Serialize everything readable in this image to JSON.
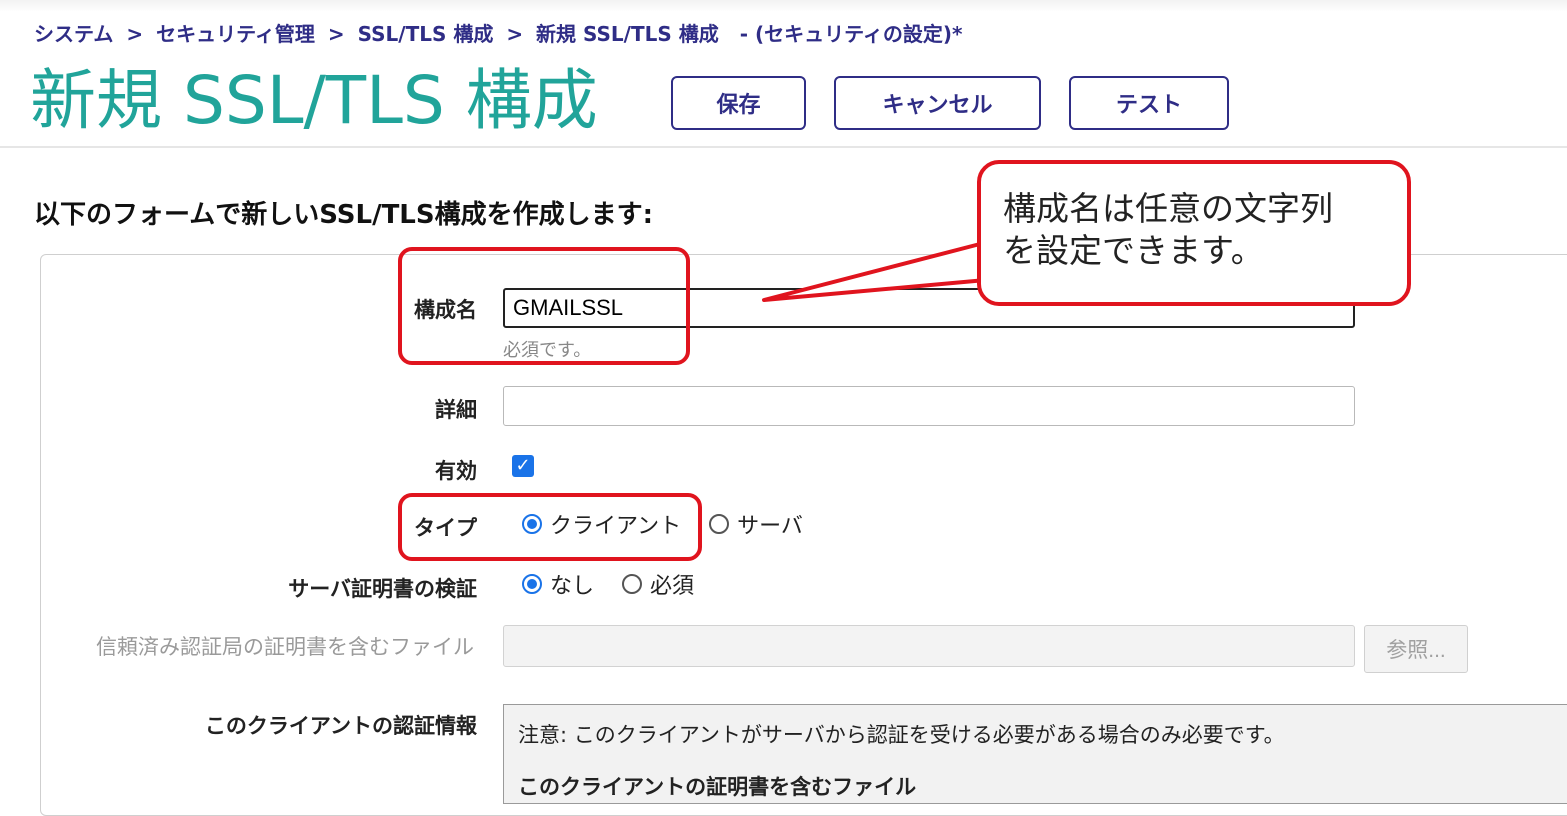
{
  "breadcrumb": {
    "items": [
      "システム",
      "セキュリティ管理",
      "SSL/TLS 構成",
      "新規 SSL/TLS 構成"
    ],
    "separator": ">",
    "suffix": "- (セキュリティの設定)*"
  },
  "header": {
    "title": "新規 SSL/TLS 構成",
    "buttons": {
      "save": "保存",
      "cancel": "キャンセル",
      "test": "テスト"
    }
  },
  "form": {
    "intro": "以下のフォームで新しいSSL/TLS構成を作成します:",
    "config_name": {
      "label": "構成名",
      "value": "GMAILSSL",
      "hint": "必須です。"
    },
    "description": {
      "label": "詳細",
      "value": ""
    },
    "enabled": {
      "label": "有効",
      "checked": true
    },
    "type": {
      "label": "タイプ",
      "options": [
        "クライアント",
        "サーバ"
      ],
      "selected": "クライアント"
    },
    "verify_server_cert": {
      "label": "サーバ証明書の検証",
      "options": [
        "なし",
        "必須"
      ],
      "selected": "なし"
    },
    "trusted_ca_file": {
      "label": "信頼済み認証局の証明書を含むファイル",
      "value": "",
      "browse_label": "参照..."
    },
    "client_credentials": {
      "label": "このクライアントの認証情報",
      "note": "注意: このクライアントがサーバから認証を受ける必要がある場合のみ必要です。",
      "sub_label": "このクライアントの証明書を含むファイル"
    }
  },
  "callout": {
    "line1": "構成名は任意の文字列",
    "line2": "を設定できます。"
  },
  "colors": {
    "title": "#21a49a",
    "breadcrumb": "#2f2d86",
    "button_border": "#2f2d86",
    "highlight": "#e0141e",
    "radio_accent": "#1a73e8"
  },
  "icons": {
    "checkbox": "checkmark-icon",
    "radio_selected": "radio-selected-icon",
    "radio_unselected": "radio-unselected-icon"
  }
}
